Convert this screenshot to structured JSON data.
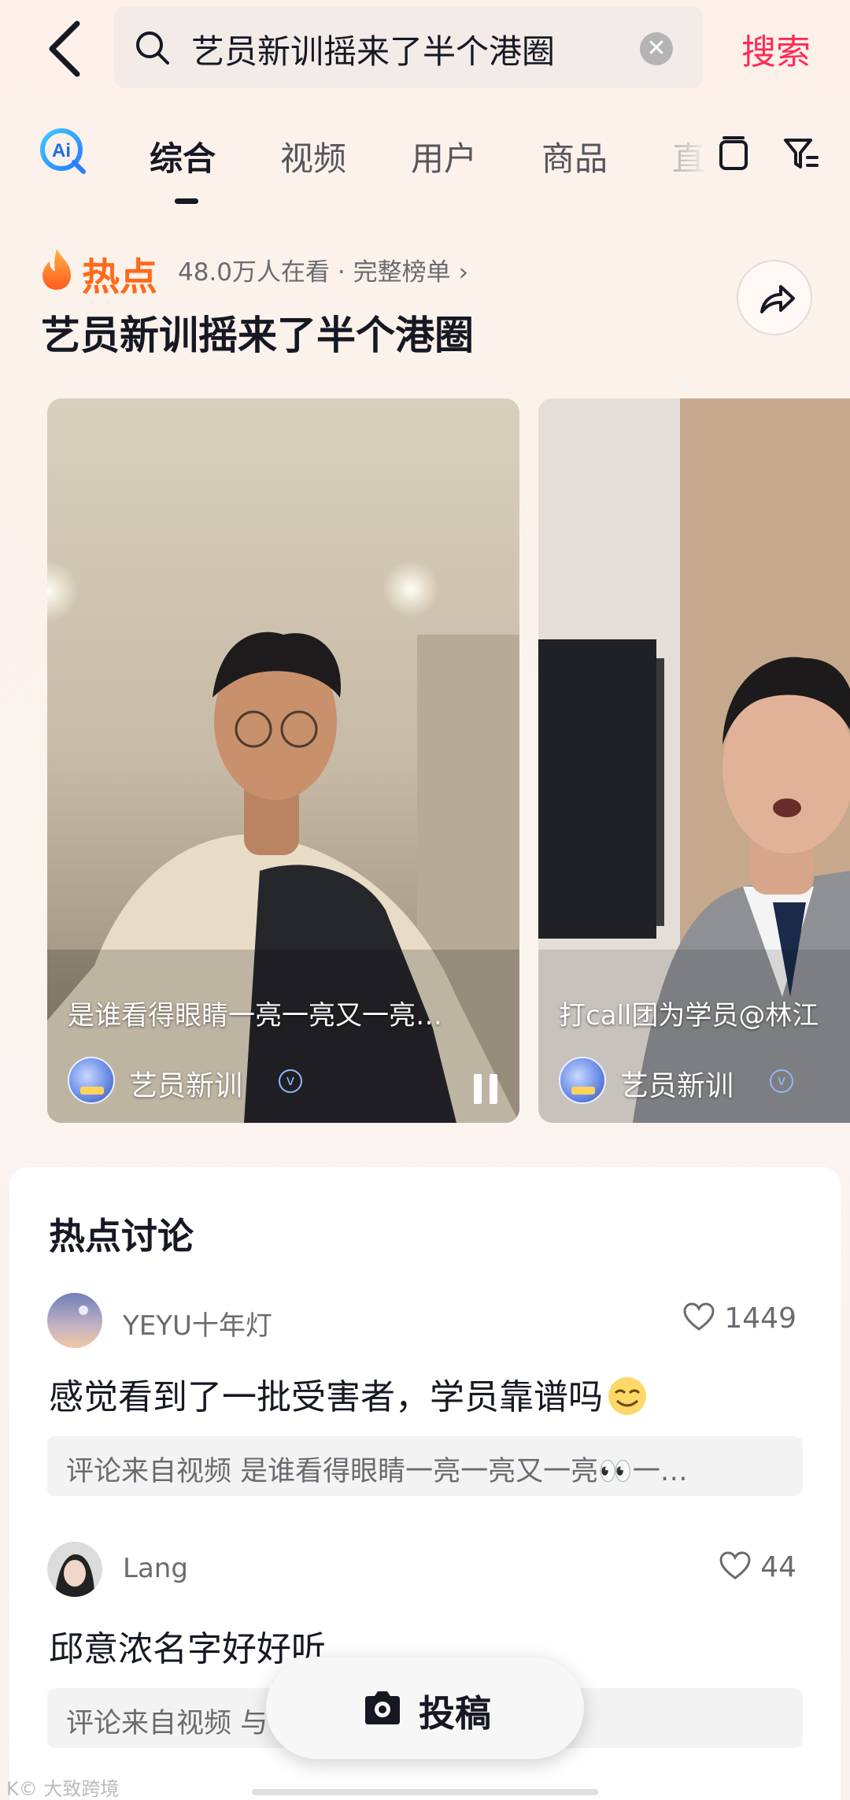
{
  "search": {
    "query": "艺员新训摇来了半个港圈",
    "clear_label": "✕",
    "action_label": "搜索"
  },
  "tabs": [
    {
      "label": "综合",
      "active": true
    },
    {
      "label": "视频",
      "active": false
    },
    {
      "label": "用户",
      "active": false
    },
    {
      "label": "商品",
      "active": false
    },
    {
      "label": "直",
      "active": false
    }
  ],
  "hot": {
    "badge": "热点",
    "viewers": "48.0万人在看 · 完整榜单",
    "chevron": "›",
    "title": "艺员新训摇来了半个港圈",
    "videos": [
      {
        "caption": "是谁看得眼睛一亮一亮又一亮…",
        "author": "艺员新训",
        "verified": "v"
      },
      {
        "caption": "打call团为学员@林江",
        "author": "艺员新训",
        "verified": "v"
      }
    ]
  },
  "discussion": {
    "title": "热点讨论",
    "comments": [
      {
        "user": "YEYU十年灯",
        "likes": "1449",
        "text": "感觉看到了一批受害者，学员靠谱吗",
        "source": "评论来自视频 是谁看得眼睛一亮一亮又一亮👀一…"
      },
      {
        "user": "Lang",
        "likes": "44",
        "text": "邱意浓名字好好听",
        "source": "评论来自视频 与艺员新训王天辰 发来…"
      }
    ]
  },
  "post_button": {
    "label": "投稿"
  },
  "watermark": "K© 大致跨境",
  "colors": {
    "accent": "#fe2c55",
    "hot": "#ff6a1a",
    "text": "#161823",
    "muted": "#6b6a70"
  }
}
